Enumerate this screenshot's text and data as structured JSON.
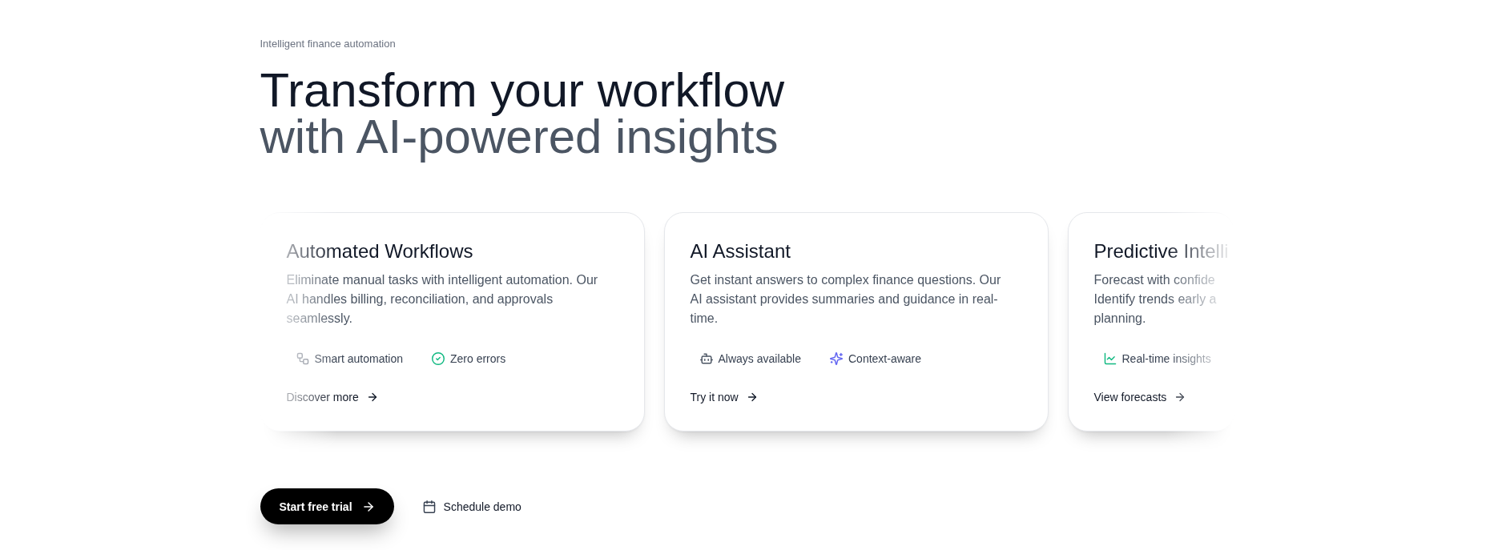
{
  "eyebrow": "Intelligent finance automation",
  "headline": {
    "main": "Transform your workflow",
    "accent": "with AI-powered insights"
  },
  "cards": [
    {
      "title": "Automated Workflows",
      "description": "Eliminate manual tasks with intelligent automation. Our AI handles billing, reconciliation, and approvals seamlessly.",
      "tags": [
        {
          "kind": "workflow",
          "label": "Smart automation"
        },
        {
          "kind": "check",
          "label": "Zero errors"
        }
      ],
      "link": "Discover more"
    },
    {
      "title": "AI Assistant",
      "description": "Get instant answers to complex finance questions. Our AI assistant provides summaries and guidance in real-time.",
      "tags": [
        {
          "kind": "bot",
          "label": "Always available"
        },
        {
          "kind": "sparkles",
          "label": "Context-aware"
        }
      ],
      "link": "Try it now"
    },
    {
      "title": "Predictive Intelli",
      "description": "Forecast with confide\nIdentify trends early a\nplanning.",
      "tags": [
        {
          "kind": "chart",
          "label": "Real-time insights"
        }
      ],
      "link": "View forecasts"
    }
  ],
  "actions": [
    {
      "kind": "primary",
      "label": "Start free trial"
    },
    {
      "kind": "secondary",
      "label": "Schedule demo"
    }
  ]
}
